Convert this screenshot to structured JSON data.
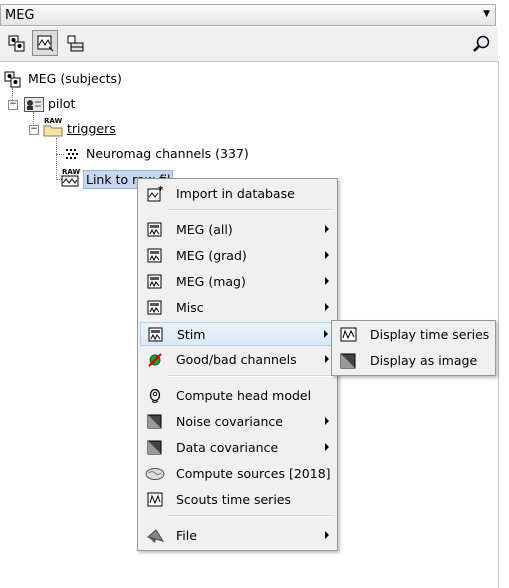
{
  "dropdown": {
    "value": "MEG"
  },
  "toolbar": {
    "buttons": [
      "subjects-view-icon",
      "functional-view-icon",
      "database-view-icon"
    ],
    "search_icon": "magnifier-icon"
  },
  "tree": {
    "root": "MEG (subjects)",
    "subject": "pilot",
    "folder": "triggers",
    "channels": "Neuromag channels (337)",
    "raw_link": "Link to raw file",
    "raw_link_visible": "Link to raw fil",
    "raw_badge": "RAW"
  },
  "context_menu": {
    "items": [
      {
        "label": "Import in database",
        "icon": "import-icon",
        "submenu": false
      },
      {
        "label": "MEG (all)",
        "icon": "recording-icon",
        "submenu": true
      },
      {
        "label": "MEG (grad)",
        "icon": "recording-icon",
        "submenu": true
      },
      {
        "label": "MEG (mag)",
        "icon": "recording-icon",
        "submenu": true
      },
      {
        "label": "Misc",
        "icon": "recording-icon",
        "submenu": true
      },
      {
        "label": "Stim",
        "icon": "recording-icon",
        "submenu": true,
        "highlighted": true
      },
      {
        "label": "Good/bad channels",
        "icon": "good-bad-icon",
        "submenu": true
      },
      {
        "label": "Compute head model",
        "icon": "head-model-icon",
        "submenu": false
      },
      {
        "label": "Noise covariance",
        "icon": "covariance-icon",
        "submenu": true
      },
      {
        "label": "Data covariance",
        "icon": "covariance-icon",
        "submenu": true
      },
      {
        "label": "Compute sources [2018]",
        "icon": "brain-icon",
        "submenu": false
      },
      {
        "label": "Scouts time series",
        "icon": "scouts-icon",
        "submenu": false
      },
      {
        "label": "File",
        "icon": "file-icon",
        "submenu": true
      }
    ]
  },
  "submenu": {
    "items": [
      {
        "label": "Display time series",
        "icon": "time-series-icon"
      },
      {
        "label": "Display as image",
        "icon": "image-icon"
      }
    ]
  }
}
